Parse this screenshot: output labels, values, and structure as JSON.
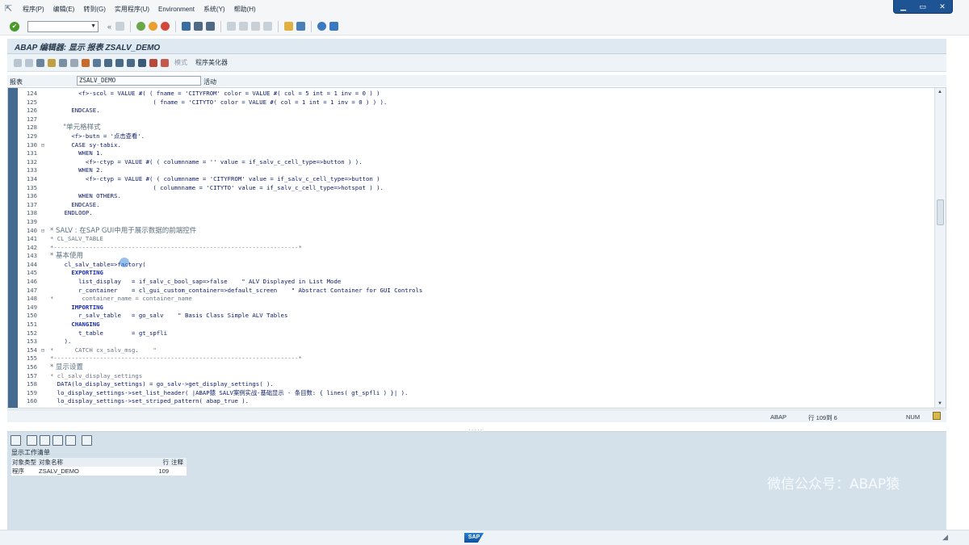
{
  "menu": {
    "items": [
      "程序(P)",
      "编辑(E)",
      "转到(G)",
      "实用程序(U)",
      "Environment",
      "系统(Y)",
      "帮助(H)"
    ]
  },
  "window_controls": [
    "▁",
    "▭",
    "✕"
  ],
  "std_toolbar": {
    "command_placeholder": "",
    "nav_symbol": "«"
  },
  "title": "ABAP 编辑器: 显示 报表 ZSALV_DEMO",
  "app_toolbar": {
    "mode_label": "模式",
    "pretty_printer_label": "程序美化器"
  },
  "program_row": {
    "label": "报表",
    "name": "ZSALV_DEMO",
    "status": "活动"
  },
  "code_lines": [
    {
      "no": "124",
      "fold": "",
      "cls": "",
      "text": "        <f>-scol = VALUE #( ( fname = 'CITYFROM' color = VALUE #( col = 5 int = 1 inv = 0 ) )"
    },
    {
      "no": "125",
      "fold": "",
      "cls": "",
      "text": "                             ( fname = 'CITYTO' color = VALUE #( col = 1 int = 1 inv = 0 ) ) )."
    },
    {
      "no": "126",
      "fold": "",
      "cls": "",
      "text": "      ENDCASE."
    },
    {
      "no": "127",
      "fold": "",
      "cls": "",
      "text": ""
    },
    {
      "no": "128",
      "fold": "",
      "cls": "cn",
      "text": "      \"单元格样式"
    },
    {
      "no": "129",
      "fold": "",
      "cls": "",
      "text": "      <f>-butn = '点击查看'."
    },
    {
      "no": "130",
      "fold": "⊟",
      "cls": "",
      "text": "      CASE sy-tabix."
    },
    {
      "no": "131",
      "fold": "",
      "cls": "",
      "text": "        WHEN 1."
    },
    {
      "no": "132",
      "fold": "",
      "cls": "",
      "text": "          <f>-ctyp = VALUE #( ( columnname = '' value = if_salv_c_cell_type=>button ) )."
    },
    {
      "no": "133",
      "fold": "",
      "cls": "",
      "text": "        WHEN 2."
    },
    {
      "no": "134",
      "fold": "",
      "cls": "",
      "text": "          <f>-ctyp = VALUE #( ( columnname = 'CITYFROM' value = if_salv_c_cell_type=>button )"
    },
    {
      "no": "135",
      "fold": "",
      "cls": "",
      "text": "                             ( columnname = 'CITYTO' value = if_salv_c_cell_type=>hotspot ) )."
    },
    {
      "no": "136",
      "fold": "",
      "cls": "",
      "text": "        WHEN OTHERS."
    },
    {
      "no": "137",
      "fold": "",
      "cls": "",
      "text": "      ENDCASE."
    },
    {
      "no": "138",
      "fold": "",
      "cls": "",
      "text": "    ENDLOOP."
    },
    {
      "no": "139",
      "fold": "",
      "cls": "",
      "text": ""
    },
    {
      "no": "140",
      "fold": "⊟",
      "cls": "cn",
      "text": "* SALV : 在SAP GUI中用于展示数据的前端控件"
    },
    {
      "no": "141",
      "fold": "",
      "cls": "comment",
      "text": "* CL_SALV_TABLE"
    },
    {
      "no": "142",
      "fold": "",
      "cls": "comment",
      "text": "*---------------------------------------------------------------------*"
    },
    {
      "no": "143",
      "fold": "",
      "cls": "cn",
      "text": "* 基本使用"
    },
    {
      "no": "144",
      "fold": "",
      "cls": "",
      "text": "    cl_salv_table=>factory("
    },
    {
      "no": "145",
      "fold": "",
      "cls": "kw",
      "text": "      EXPORTING"
    },
    {
      "no": "146",
      "fold": "",
      "cls": "",
      "text": "        list_display   = if_salv_c_bool_sap=>false    \" ALV Displayed in List Mode"
    },
    {
      "no": "147",
      "fold": "",
      "cls": "",
      "text": "        r_container    = cl_gui_custom_container=>default_screen    \" Abstract Container for GUI Controls"
    },
    {
      "no": "148",
      "fold": "",
      "cls": "comment",
      "text": "*        container_name = container_name"
    },
    {
      "no": "149",
      "fold": "",
      "cls": "kw",
      "text": "      IMPORTING"
    },
    {
      "no": "150",
      "fold": "",
      "cls": "",
      "text": "        r_salv_table   = go_salv    \" Basis Class Simple ALV Tables"
    },
    {
      "no": "151",
      "fold": "",
      "cls": "kw",
      "text": "      CHANGING"
    },
    {
      "no": "152",
      "fold": "",
      "cls": "",
      "text": "        t_table        = gt_spfli"
    },
    {
      "no": "153",
      "fold": "",
      "cls": "",
      "text": "    )."
    },
    {
      "no": "154",
      "fold": "⊟",
      "cls": "comment",
      "text": "*      CATCH cx_salv_msg.    \""
    },
    {
      "no": "155",
      "fold": "",
      "cls": "comment",
      "text": "*---------------------------------------------------------------------*"
    },
    {
      "no": "156",
      "fold": "",
      "cls": "cn",
      "text": "* 显示设置"
    },
    {
      "no": "157",
      "fold": "",
      "cls": "comment",
      "text": "* cl_salv_display_settings"
    },
    {
      "no": "158",
      "fold": "",
      "cls": "",
      "text": "  DATA(lo_display_settings) = go_salv->get_display_settings( )."
    },
    {
      "no": "159",
      "fold": "",
      "cls": "",
      "text": "  lo_display_settings->set_list_header( |ABAP猿 SALV案例实战-基础显示 - 条目数: { lines( gt_spfli ) }| )."
    },
    {
      "no": "160",
      "fold": "",
      "cls": "",
      "text": "  lo_display_settings->set_striped_pattern( abap_true )."
    }
  ],
  "status": {
    "lang": "ABAP",
    "position": "行 109到 6",
    "mode": "NUM"
  },
  "worklist": {
    "title": "显示工作清单",
    "headers": [
      "对象类型",
      "对象名称",
      "行",
      "注释"
    ],
    "rows": [
      {
        "type": "程序",
        "name": "ZSALV_DEMO",
        "line": "109",
        "comment": ""
      }
    ]
  },
  "watermark": "微信公众号：ABAP猿",
  "footer": {
    "logo": "SAP"
  },
  "colors": {
    "left_bar": "#446b8f",
    "panel_bg": "#d4e1ea",
    "keyword": "#1a2cb0"
  }
}
